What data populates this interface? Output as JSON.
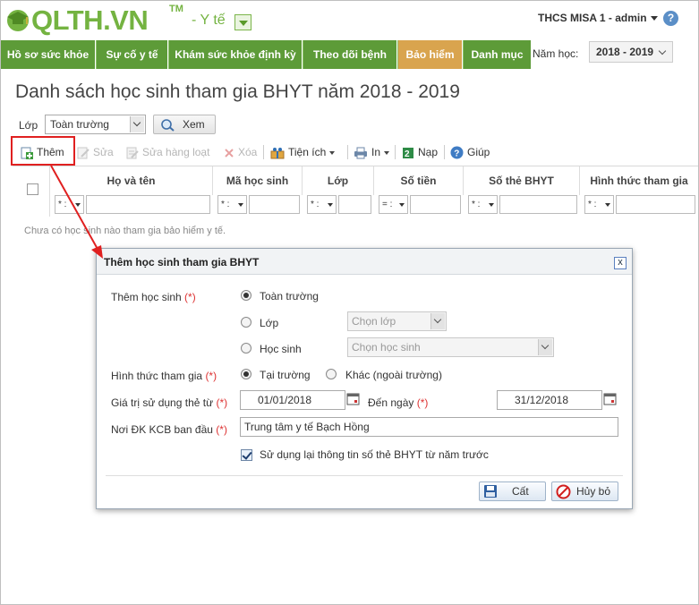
{
  "header": {
    "logo_text": "QLTH.VN",
    "logo_tm": "TM",
    "module": "- Y tế",
    "user": "THCS MISA 1 - admin",
    "help_glyph": "?"
  },
  "nav": {
    "items": [
      "Hồ sơ sức khỏe",
      "Sự cố y tế",
      "Khám sức khỏe định kỳ",
      "Theo dõi bệnh",
      "Bảo hiểm",
      "Danh mục"
    ],
    "active_index": 4,
    "year_label": "Năm học:",
    "year_value": "2018 - 2019"
  },
  "page": {
    "title": "Danh sách học sinh tham gia BHYT năm 2018 - 2019",
    "class_label": "Lớp",
    "class_value": "Toàn trường",
    "view_button": "Xem"
  },
  "toolbar": {
    "add": "Thêm",
    "edit": "Sửa",
    "bulk_edit": "Sửa hàng loạt",
    "delete": "Xóa",
    "utilities": "Tiện ích",
    "print": "In",
    "import": "Nạp",
    "help": "Giúp"
  },
  "grid": {
    "columns": [
      "Họ và tên",
      "Mã học sinh",
      "Lớp",
      "Số tiền",
      "Số thẻ BHYT",
      "Hình thức tham gia"
    ],
    "filter_ops": [
      "* :",
      "* :",
      "* :",
      "= :",
      "* :",
      "* :"
    ],
    "empty_message": "Chưa có học sinh nào tham gia bảo hiểm y tế."
  },
  "dialog": {
    "title": "Thêm học sinh tham gia BHYT",
    "close_glyph": "x",
    "add_student_label": "Thêm học sinh",
    "required_mark": "(*)",
    "opt_whole_school": "Toàn trường",
    "opt_class": "Lớp",
    "opt_student": "Học sinh",
    "class_placeholder": "Chọn lớp",
    "student_placeholder": "Chọn học sinh",
    "participation_label": "Hình thức tham gia",
    "opt_at_school": "Tại trường",
    "opt_other": "Khác (ngoài trường)",
    "valid_from_label": "Giá trị sử dụng thẻ từ",
    "valid_from": "01/01/2018",
    "to_label": "Đến ngày",
    "valid_to": "31/12/2018",
    "hospital_label": "Nơi ĐK KCB ban đầu",
    "hospital_value": "Trung tâm y tế Bạch Hồng",
    "reuse_label": "Sử dụng lại thông tin số thẻ BHYT từ năm trước",
    "save_button": "Cất",
    "cancel_button": "Hủy bỏ"
  },
  "colors": {
    "brand_green": "#74b341",
    "nav_green": "#5d9b38",
    "nav_active": "#d9a44e",
    "required_red": "#d33333",
    "highlight_red": "#e02020"
  }
}
